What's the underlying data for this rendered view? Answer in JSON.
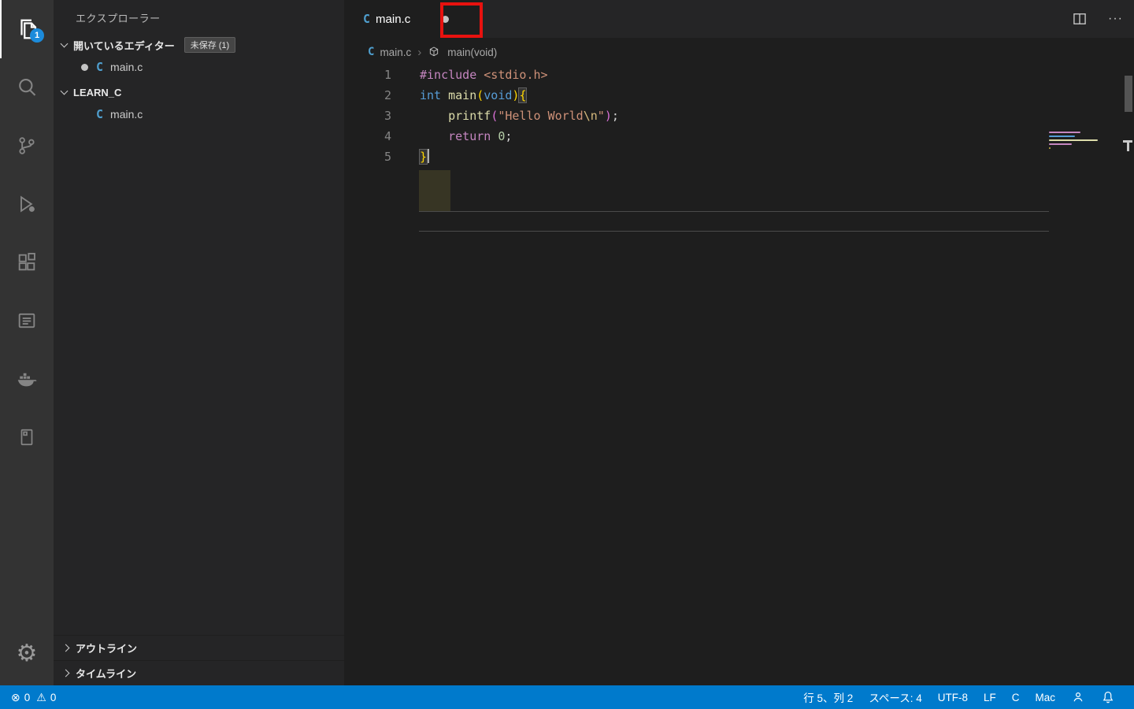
{
  "activity_bar": {
    "badge": "1",
    "items": [
      {
        "id": "explorer",
        "icon": "files-icon",
        "active": true
      },
      {
        "id": "search",
        "icon": "search-icon",
        "active": false
      },
      {
        "id": "source-control",
        "icon": "git-branch-icon",
        "active": false
      },
      {
        "id": "run-debug",
        "icon": "debug-play-icon",
        "active": false
      },
      {
        "id": "extensions",
        "icon": "extensions-icon",
        "active": false
      },
      {
        "id": "output-list",
        "icon": "list-box-icon",
        "active": false
      },
      {
        "id": "docker",
        "icon": "docker-whale-icon",
        "active": false
      },
      {
        "id": "notebook",
        "icon": "notebook-icon",
        "active": false
      },
      {
        "id": "settings",
        "icon": "gear-icon",
        "active": false
      }
    ]
  },
  "sidebar": {
    "title": "エクスプローラー",
    "open_editors": {
      "label": "開いているエディター",
      "badge": "未保存 (1)",
      "items": [
        {
          "file": "main.c",
          "modified": true
        }
      ]
    },
    "workspace": {
      "label": "LEARN_C",
      "items": [
        {
          "file": "main.c"
        }
      ]
    },
    "outline_label": "アウトライン",
    "timeline_label": "タイムライン"
  },
  "editor": {
    "tab": {
      "label": "main.c",
      "modified": true,
      "active": true
    },
    "more_actions_label": "···",
    "breadcrumb": {
      "file": "main.c",
      "symbol": "main(void)"
    },
    "cursor": {
      "line": 5,
      "column": 2
    },
    "code": {
      "language": "c",
      "lines": [
        {
          "num": "1",
          "tokens": [
            {
              "t": "#include",
              "c": "preproc"
            },
            {
              "t": " ",
              "c": "plain"
            },
            {
              "t": "<stdio.h>",
              "c": "string"
            }
          ]
        },
        {
          "num": "2",
          "tokens": [
            {
              "t": "int",
              "c": "kw"
            },
            {
              "t": " ",
              "c": "plain"
            },
            {
              "t": "main",
              "c": "func"
            },
            {
              "t": "(",
              "c": "b1"
            },
            {
              "t": "void",
              "c": "kw"
            },
            {
              "t": ")",
              "c": "b1"
            },
            {
              "t": "{",
              "c": "b1",
              "m": true
            }
          ]
        },
        {
          "num": "3",
          "tokens": [
            {
              "t": "    ",
              "c": "plain"
            },
            {
              "t": "printf",
              "c": "func"
            },
            {
              "t": "(",
              "c": "b2"
            },
            {
              "t": "\"Hello World",
              "c": "string"
            },
            {
              "t": "\\n",
              "c": "esc"
            },
            {
              "t": "\"",
              "c": "string"
            },
            {
              "t": ")",
              "c": "b2"
            },
            {
              "t": ";",
              "c": "plain"
            }
          ]
        },
        {
          "num": "4",
          "tokens": [
            {
              "t": "    ",
              "c": "plain"
            },
            {
              "t": "return",
              "c": "preproc"
            },
            {
              "t": " ",
              "c": "plain"
            },
            {
              "t": "0",
              "c": "num"
            },
            {
              "t": ";",
              "c": "plain"
            }
          ]
        },
        {
          "num": "5",
          "tokens": [
            {
              "t": "}",
              "c": "b1",
              "m": true
            }
          ],
          "cursor": true
        }
      ]
    }
  },
  "status_bar": {
    "errors": "0",
    "warnings": "0",
    "line_col": "行 5、列 2",
    "indent": "スペース: 4",
    "encoding": "UTF-8",
    "eol": "LF",
    "language": "C",
    "remote_os": "Mac"
  },
  "annotation": {
    "description": "red highlight box around unsaved-changes dot in editor tab"
  },
  "colors": {
    "status_bar": "#007acc",
    "activity_badge": "#1c8bdb",
    "annotation_red": "#e8120f",
    "editor_bg": "#1e1e1e",
    "sidebar_bg": "#252526",
    "activity_bar_bg": "#333333"
  }
}
